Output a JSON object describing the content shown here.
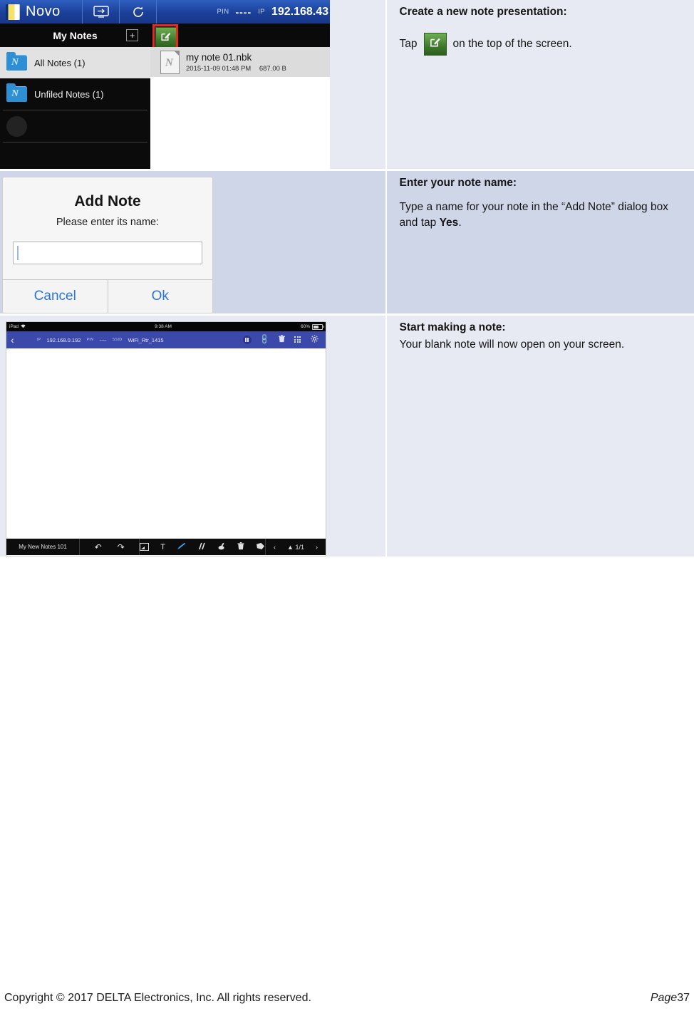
{
  "rows": [
    {
      "heading": "Create a new note presentation:",
      "tap_prefix": "Tap",
      "tap_suffix": "on the top of the screen.",
      "screenshot": {
        "type": "novo-my-notes",
        "toolbar": {
          "app_name": "Novo",
          "logo_icon": "novo-logo-icon",
          "present_icon": "present-screen-icon",
          "refresh_icon": "refresh-icon",
          "pin_label": "PIN",
          "pin_value": "----",
          "ip_label": "IP",
          "ip_value": "192.168.43"
        },
        "panel": {
          "title": "My Notes",
          "add_icon": "plus-box-icon",
          "new_note_icon": "new-note-icon"
        },
        "sidebar": [
          {
            "label": "All Notes (1)",
            "icon": "folder-icon",
            "selected": true
          },
          {
            "label": "Unfiled Notes (1)",
            "icon": "folder-icon",
            "selected": false
          }
        ],
        "files": [
          {
            "name": "my note 01.nbk",
            "date": "2015-11-09 01:48 PM",
            "size": "687.00 B",
            "icon": "note-file-icon"
          }
        ]
      }
    },
    {
      "heading": "Enter your note name:",
      "body_part1": "Type a name for your note in the “Add Note” dialog box and tap ",
      "body_bold": "Yes",
      "body_part2": ".",
      "screenshot": {
        "type": "add-note-dialog",
        "title": "Add Note",
        "subtitle": "Please enter its name:",
        "input_value": "",
        "input_placeholder": "",
        "cancel_label": "Cancel",
        "ok_label": "Ok"
      }
    },
    {
      "heading": "Start making a note:",
      "body": "Your blank note will now open on your screen.",
      "screenshot": {
        "type": "tablet-note-canvas",
        "status_bar": {
          "device": "iPad",
          "wifi_icon": "wifi-icon",
          "time": "9:38 AM",
          "battery_percent": "60%",
          "battery_icon": "battery-icon"
        },
        "top_bar": {
          "back_icon": "back-chevron-icon",
          "ip_label": "IP",
          "ip_value": "192.168.0.192",
          "pin_label": "PIN",
          "pin_value": "----",
          "ssid_label": "SSID",
          "ssid_value": "WiFi_Rtr_1415",
          "icons": [
            "pause-icon",
            "link-icon",
            "trash-icon",
            "grid-icon",
            "gear-icon"
          ]
        },
        "bottom_bar": {
          "note_name": "My New Notes 101",
          "undo_icon": "undo-icon",
          "redo_icon": "redo-icon",
          "tools": [
            {
              "name": "image-icon",
              "selected": false
            },
            {
              "name": "text-icon",
              "selected": false,
              "glyph": "T"
            },
            {
              "name": "pen-icon",
              "selected": true
            },
            {
              "name": "marker-icon",
              "selected": false
            },
            {
              "name": "eraser-icon",
              "selected": false
            },
            {
              "name": "trash-icon",
              "selected": false
            },
            {
              "name": "hand-icon",
              "selected": false
            }
          ],
          "prev_icon": "prev-page-icon",
          "page_icon": "page-stack-icon",
          "page_indicator": "1/1",
          "next_icon": "next-page-icon"
        }
      }
    }
  ],
  "footer": {
    "copyright": "Copyright © 2017 DELTA Electronics, Inc. All rights reserved.",
    "page_label": "Page",
    "page_number": "37"
  },
  "colors": {
    "row_light": "#e7eaf3",
    "row_dark": "#ced6e8",
    "novo_blue": "#1b3f99",
    "highlight_red": "#e62a20",
    "note_green": "#3f7a2c",
    "dialog_link": "#2b74d8"
  }
}
